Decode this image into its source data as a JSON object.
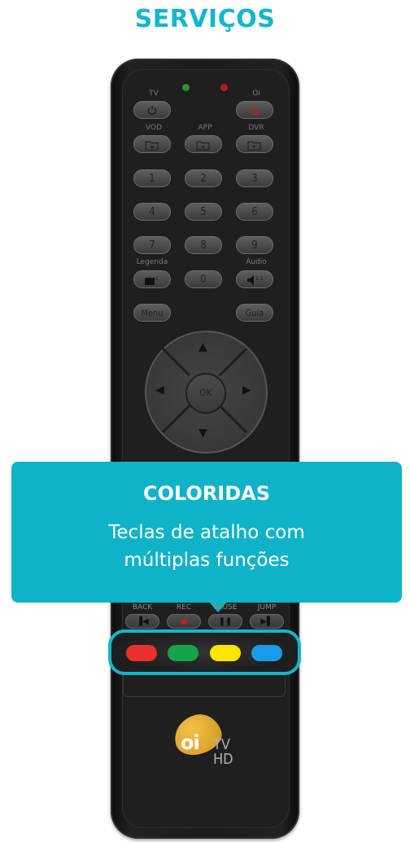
{
  "page": {
    "title": "SERVIÇOS",
    "accent_color": "#12b7cc"
  },
  "remote": {
    "labels": {
      "tv": "TV",
      "oi": "Oi",
      "vod": "VOD",
      "app": "APP",
      "dvr": "DVR",
      "legenda": "Legenda",
      "audio": "Áudio"
    },
    "keys": {
      "n1": "1",
      "n2": "2",
      "n3": "3",
      "n4": "4",
      "n5": "5",
      "n6": "6",
      "n7": "7",
      "n8": "8",
      "n9": "9",
      "n0": "0",
      "menu": "Menu",
      "guia": "Guia",
      "ok": "OK"
    },
    "transport_labels": {
      "back": "BACK",
      "rec": "REC",
      "pause": "PAUSE",
      "jump": "JUMP"
    },
    "color_keys": [
      "#e8302f",
      "#14a54a",
      "#ffe500",
      "#1a9be8"
    ],
    "led_colors": [
      "#2f8f3a",
      "#b21d1d"
    ]
  },
  "tooltip": {
    "title": "COLORIDAS",
    "line1": "Teclas de atalho com",
    "line2": "múltiplas funções"
  },
  "logo": {
    "brand": "oi",
    "tv": "TV",
    "hd": "HD"
  }
}
